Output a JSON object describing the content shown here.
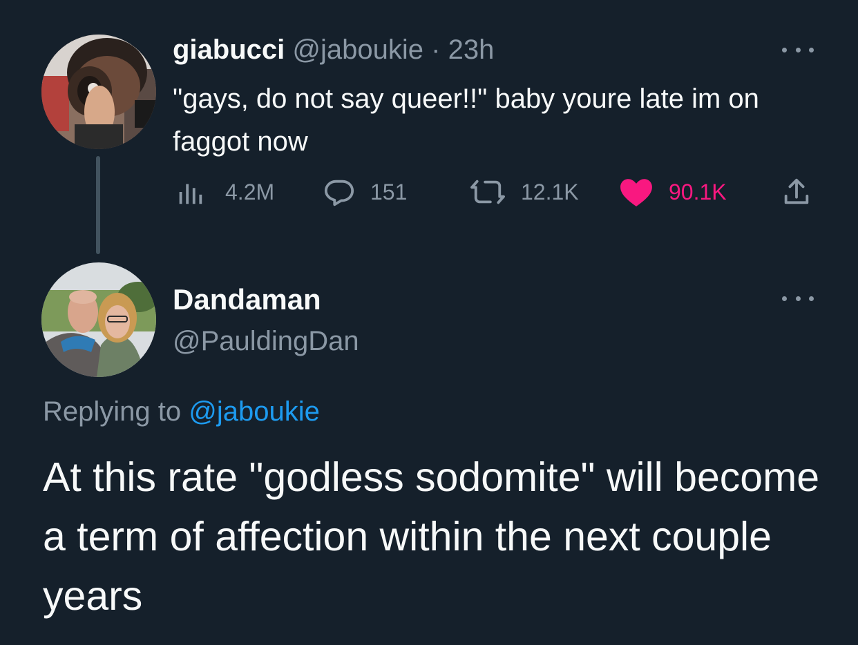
{
  "tweet1": {
    "display_name": "giabucci",
    "handle": "@jaboukie",
    "separator": "·",
    "time": "23h",
    "text": "\"gays, do not say queer!!\" baby youre late im on faggot now",
    "stats": {
      "views": "4.2M",
      "replies": "151",
      "retweets": "12.1K",
      "likes": "90.1K"
    },
    "icons": {
      "more": "more-dots-icon",
      "views": "views-bar-icon",
      "reply": "reply-bubble-icon",
      "retweet": "retweet-icon",
      "like": "heart-icon",
      "share": "share-icon"
    }
  },
  "tweet2": {
    "display_name": "Dandaman",
    "handle": "@PauldingDan",
    "replying_prefix": "Replying to",
    "replying_to": "@jaboukie",
    "text": "At this rate \"godless sodomite\" will become a term of affection within the next couple years"
  },
  "colors": {
    "background": "#15202b",
    "primary_text": "#f7f9f9",
    "secondary_text": "#8b98a5",
    "link": "#1d9bf0",
    "like": "#f91880",
    "thread_line": "#42535f"
  }
}
